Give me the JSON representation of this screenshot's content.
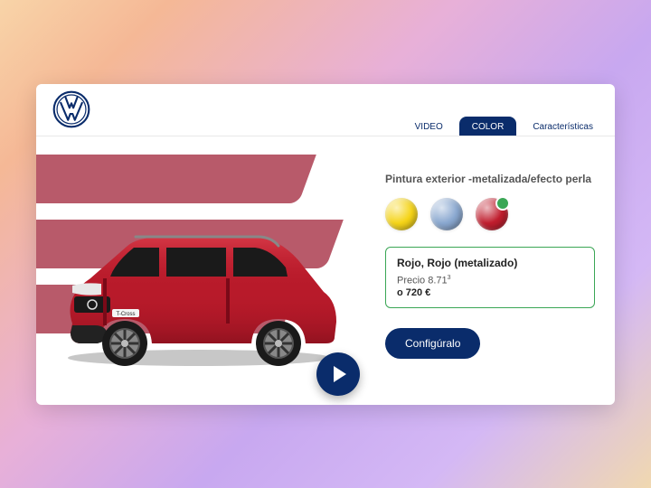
{
  "tabs": {
    "video": "VIDEO",
    "color": "COLOR",
    "features": "Características"
  },
  "activeTab": "color",
  "colorPanel": {
    "title": "Pintura exterior -metalizada/efecto perla",
    "swatches": [
      {
        "name": "amarillo",
        "hex": "#f5d418"
      },
      {
        "name": "azul",
        "hex": "#8aa8d0"
      },
      {
        "name": "rojo",
        "hex": "#c01e2e"
      }
    ],
    "selectedIndex": 2,
    "detail": {
      "name": "Rojo, Rojo (metalizado)",
      "priceLabel": "Precio 8.71",
      "priceNote": "3",
      "altPrice": "o 720 €"
    },
    "cta": "Configúralo"
  }
}
